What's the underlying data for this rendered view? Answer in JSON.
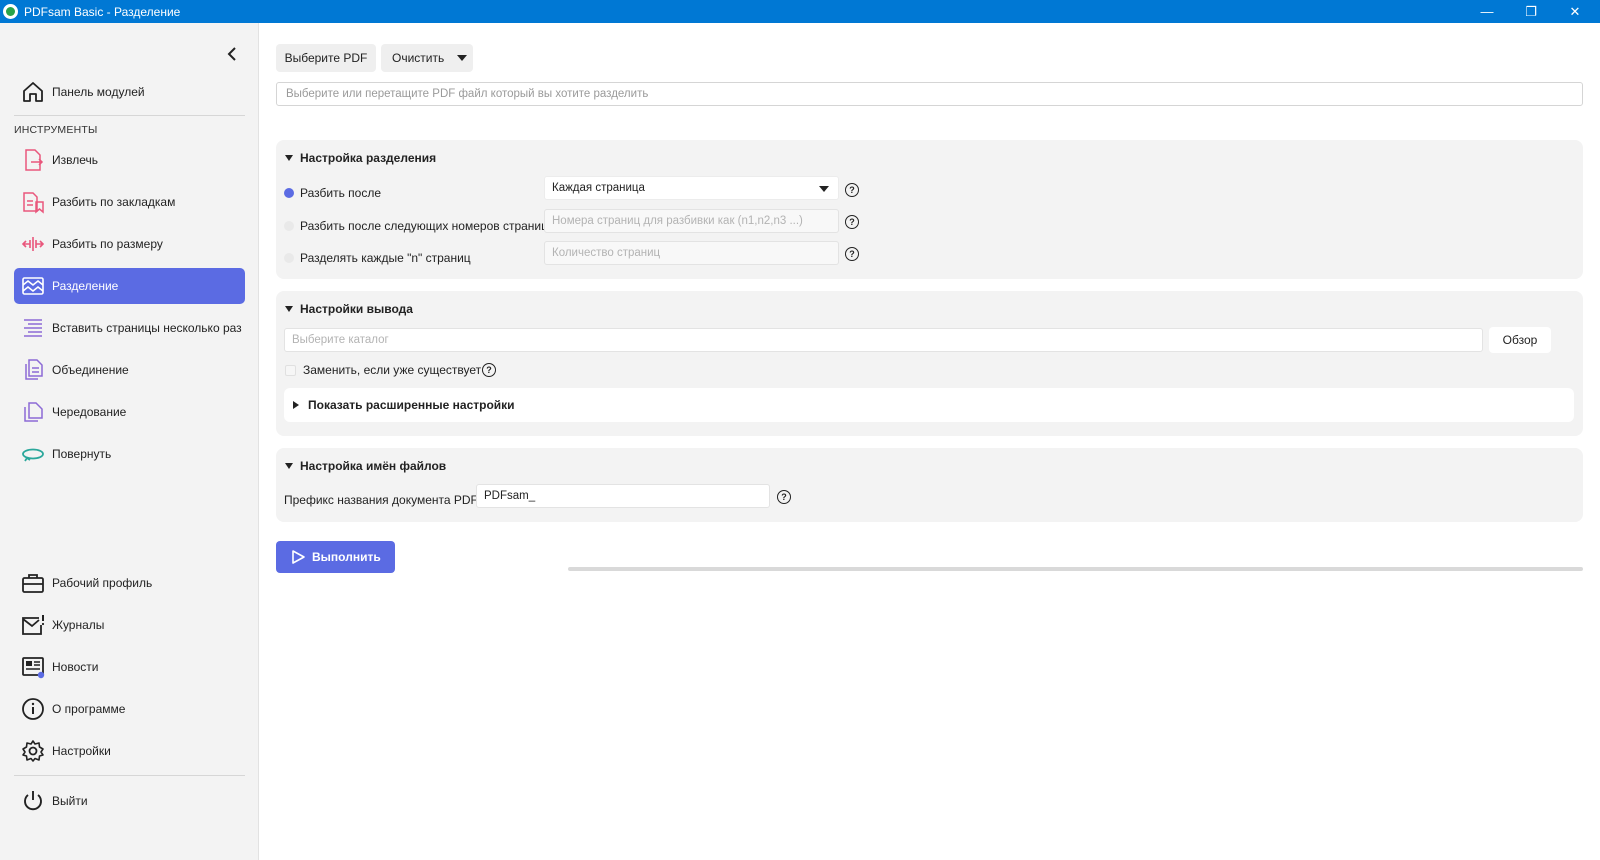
{
  "window": {
    "title": "PDFsam Basic - Разделение",
    "minimize_glyph": "—",
    "maximize_glyph": "❐",
    "close_glyph": "✕"
  },
  "sidebar": {
    "dashboard": {
      "label": "Панель модулей",
      "icon": "home-icon"
    },
    "tools_header": "ИНСТРУМЕНТЫ",
    "items": [
      {
        "label": "Извлечь",
        "icon": "extract-icon"
      },
      {
        "label": "Разбить по закладкам",
        "icon": "split-bookmarks-icon"
      },
      {
        "label": "Разбить по размеру",
        "icon": "split-size-icon"
      },
      {
        "label": "Разделение",
        "icon": "split-icon",
        "active": true
      },
      {
        "label": "Вставить страницы несколько раз",
        "icon": "insert-pages-icon"
      },
      {
        "label": "Объединение",
        "icon": "merge-icon"
      },
      {
        "label": "Чередование",
        "icon": "alternate-mix-icon"
      },
      {
        "label": "Повернуть",
        "icon": "rotate-icon"
      }
    ],
    "bottom_items": [
      {
        "label": "Рабочий профиль",
        "icon": "briefcase-icon"
      },
      {
        "label": "Журналы",
        "icon": "logs-icon"
      },
      {
        "label": "Новости",
        "icon": "news-icon"
      },
      {
        "label": "О программе",
        "icon": "info-icon"
      },
      {
        "label": "Настройки",
        "icon": "gear-icon"
      }
    ],
    "exit": {
      "label": "Выйти",
      "icon": "power-icon"
    }
  },
  "toolbar": {
    "select_pdf_label": "Выберите PDF",
    "clear_label": "Очистить",
    "file_placeholder": "Выберите или перетащите PDF файл который вы хотите разделить"
  },
  "split_settings": {
    "title": "Настройка разделения",
    "option_after_label": "Разбить после",
    "option_after_value": "Каждая страница",
    "option_pages_label": "Разбить после следующих номеров страниц",
    "option_pages_placeholder": "Номера страниц для разбивки как (n1,n2,n3 ...)",
    "option_every_label": "Разделять каждые \"n\" страниц",
    "option_every_placeholder": "Количество страниц",
    "help_glyph": "?"
  },
  "output_settings": {
    "title": "Настройки вывода",
    "directory_placeholder": "Выберите каталог",
    "browse_label": "Обзор",
    "overwrite_label": "Заменить, если уже существует",
    "advanced_label": "Показать расширенные настройки"
  },
  "filename_settings": {
    "title": "Настройка имён файлов",
    "prefix_label": "Префикс названия документа PDF:",
    "prefix_value": "PDFsam_"
  },
  "run": {
    "label": "Выполнить",
    "progress_percent": 0
  },
  "colors": {
    "accent": "#5b6be3",
    "titlebar": "#0078d4",
    "sidebar_bg": "#f3f3f3",
    "icon_pink": "#e9577c",
    "icon_purple": "#8c6bd6",
    "icon_teal": "#2aa79b"
  }
}
